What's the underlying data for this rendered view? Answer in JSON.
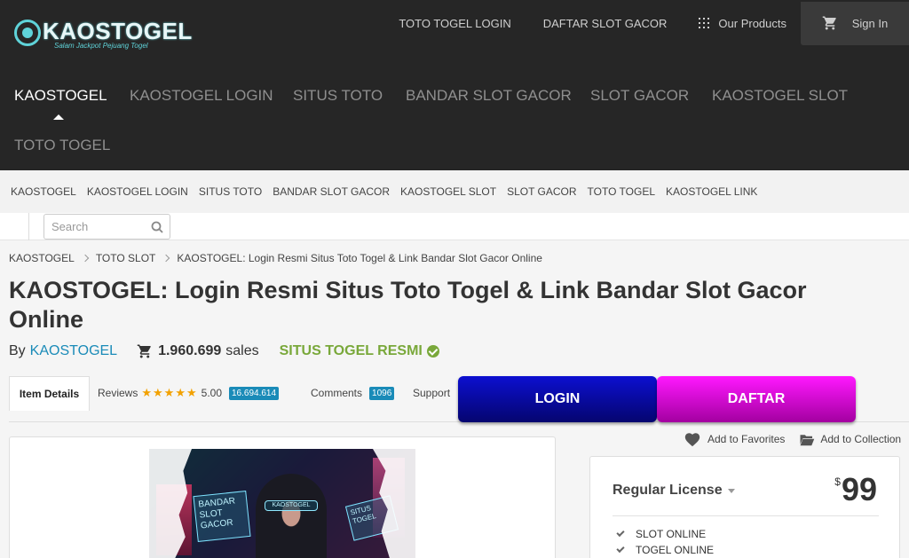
{
  "logo": {
    "word": "KAOSTOGEL",
    "tagline": "Salam Jackpot Pejuang Togel"
  },
  "header": {
    "links": [
      "TOTO TOGEL LOGIN",
      "DAFTAR SLOT GACOR"
    ],
    "products_label": "Our Products",
    "signin_label": "Sign In"
  },
  "main_nav": [
    "KAOSTOGEL",
    "KAOSTOGEL LOGIN",
    "SITUS TOTO",
    "BANDAR SLOT GACOR",
    "SLOT GACOR",
    "KAOSTOGEL SLOT",
    "TOTO TOGEL"
  ],
  "sub_nav": [
    "KAOSTOGEL",
    "KAOSTOGEL LOGIN",
    "SITUS TOTO",
    "BANDAR SLOT GACOR",
    "KAOSTOGEL SLOT",
    "SLOT GACOR",
    "TOTO TOGEL",
    "KAOSTOGEL LINK"
  ],
  "search": {
    "placeholder": "Search"
  },
  "breadcrumb": [
    "KAOSTOGEL",
    "TOTO SLOT",
    "KAOSTOGEL: Login Resmi Situs Toto Togel & Link Bandar Slot Gacor Online"
  ],
  "item": {
    "title": "KAOSTOGEL: Login Resmi Situs Toto Togel & Link Bandar Slot Gacor Online",
    "by_label": "By",
    "author": "KAOSTOGEL",
    "sales_count": "1.960.699",
    "sales_label": "sales",
    "badge": "SITUS TOGEL RESMI"
  },
  "tabs": {
    "item_details": "Item Details",
    "reviews": "Reviews",
    "stars": "★★★★★",
    "rating": "5.00",
    "reviews_count": "16.694.614",
    "comments": "Comments",
    "comments_count": "1096",
    "support": "Support"
  },
  "buttons": {
    "login": "LOGIN",
    "daftar": "DAFTAR"
  },
  "preview": {
    "sign_text": "BANDAR SLOT GACOR",
    "sign2_text": "SITUS TOGEL",
    "visor_text": "KAOSTOGEL"
  },
  "actions": {
    "favorites": "Add to Favorites",
    "collection": "Add to Collection"
  },
  "license": {
    "name": "Regular License",
    "currency": "$",
    "price": "99",
    "features": [
      "SLOT ONLINE",
      "TOGEL ONLINE"
    ]
  },
  "colors": {
    "header_bg": "#262626",
    "link_blue": "#1a8bb8",
    "resmi_green": "#79a83a",
    "login_blue": "#0c0fd0",
    "daftar_pink": "#ff18ff"
  }
}
